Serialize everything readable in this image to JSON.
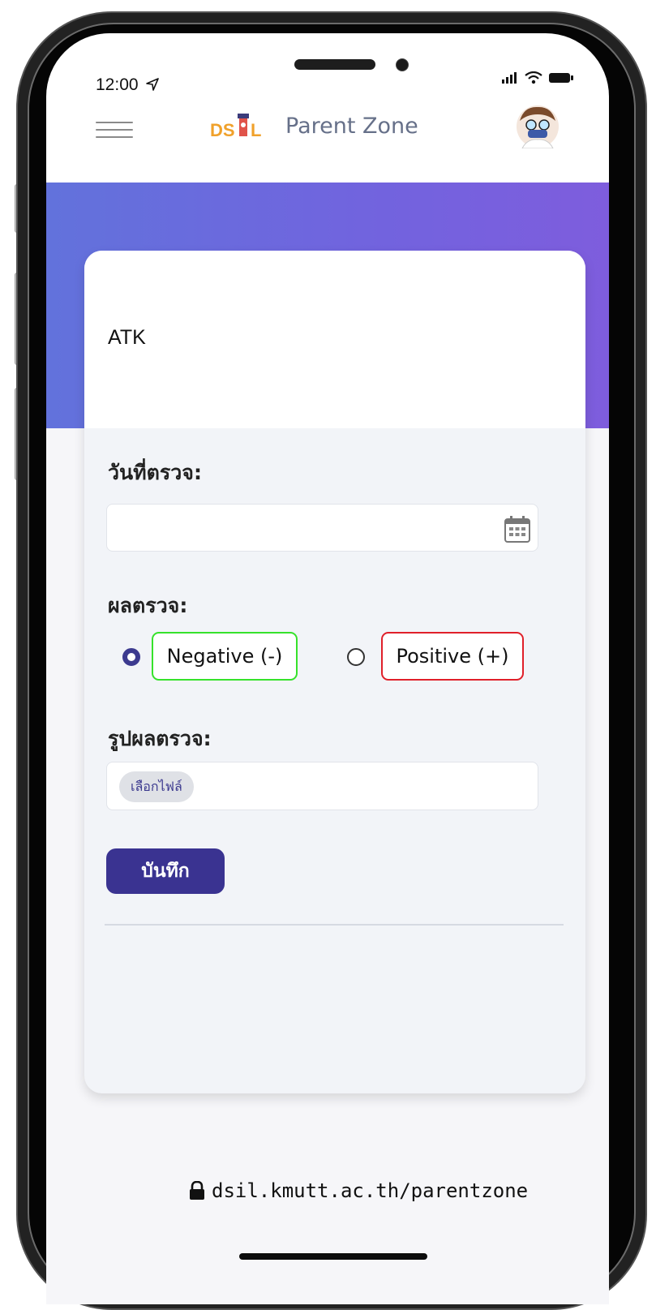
{
  "status_bar": {
    "time": "12:00"
  },
  "header": {
    "app_title": "Parent Zone"
  },
  "card": {
    "title": "ATK",
    "date_label": "วันที่ตรวจ:",
    "result_label": "ผลตรวจ:",
    "options": [
      {
        "label": "Negative (-)",
        "selected": true,
        "color": "#36e22b"
      },
      {
        "label": "Positive (+)",
        "selected": false,
        "color": "#e0202a"
      }
    ],
    "image_label": "รูปผลตรวจ:",
    "file_button_label": "เลือกไฟล์",
    "save_label": "บันทึก"
  },
  "browser": {
    "url": "dsil.kmutt.ac.th/parentzone"
  },
  "colors": {
    "accent": "#3a3391",
    "banner_start": "#6272dc",
    "banner_end": "#7e5ddd"
  },
  "icons": [
    "location-arrow-icon",
    "signal-icon",
    "wifi-icon",
    "battery-icon",
    "menu-icon",
    "calendar-icon",
    "lock-icon"
  ]
}
